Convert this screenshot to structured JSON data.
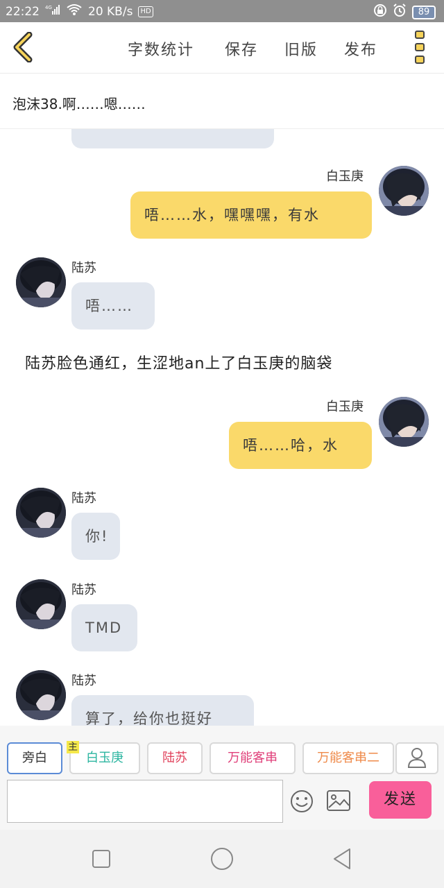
{
  "status_bar": {
    "time": "22:22",
    "network_type": "4G",
    "speed": "20 KB/s",
    "hd_label": "HD",
    "battery": "89"
  },
  "toolbar": {
    "word_count_label": "字数统计",
    "save_label": "保存",
    "old_version_label": "旧版",
    "publish_label": "发布"
  },
  "story": {
    "title": "泡沫38.啊……嗯……"
  },
  "messages": [
    {
      "speaker": "白玉庚",
      "side": "right",
      "text": "唔……水，嘿嘿嘿，有水"
    },
    {
      "speaker": "陆苏",
      "side": "left",
      "text": "唔……"
    },
    {
      "speaker": "",
      "side": "narration",
      "text": "陆苏脸色通红，生涩地an上了白玉庚的脑袋"
    },
    {
      "speaker": "白玉庚",
      "side": "right",
      "text": "唔……哈，水"
    },
    {
      "speaker": "陆苏",
      "side": "left",
      "text": "你!"
    },
    {
      "speaker": "陆苏",
      "side": "left",
      "text": "TMD"
    },
    {
      "speaker": "陆苏",
      "side": "left",
      "text": "算了，给你也挺好"
    }
  ],
  "roles": {
    "items": [
      {
        "label": "旁白",
        "color": "#333333",
        "active": true
      },
      {
        "label": "白玉庚",
        "color": "#2bb5a0",
        "badge": "主"
      },
      {
        "label": "陆苏",
        "color": "#e0405a"
      },
      {
        "label": "万能客串",
        "color": "#e0407a"
      },
      {
        "label": "万能客串二",
        "color": "#ef8a4a"
      }
    ]
  },
  "input": {
    "placeholder": "",
    "send_label": "发送"
  },
  "colors": {
    "accent_yellow": "#fad96a",
    "left_bubble": "#e2e7ef",
    "send_pink": "#f95f9a",
    "status_bar": "#8f8f8f"
  }
}
